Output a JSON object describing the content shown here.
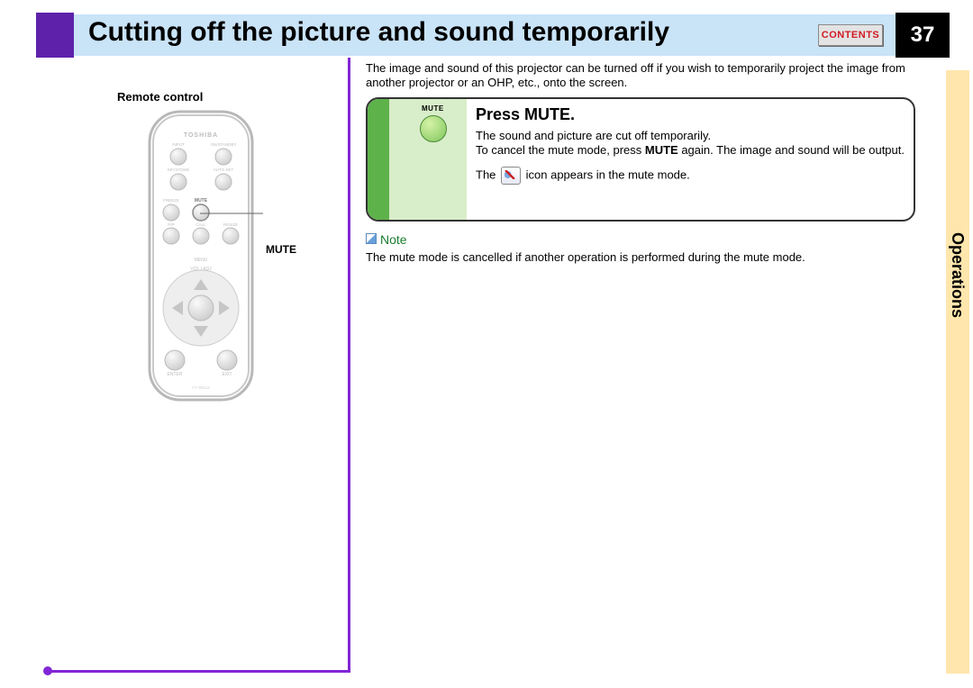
{
  "header": {
    "title": "Cutting off the picture and sound temporarily",
    "contents_label": "CONTENTS",
    "page_number": "37"
  },
  "sidetab": {
    "label": "Operations"
  },
  "left": {
    "caption": "Remote control",
    "callout": "MUTE",
    "brand": "TOSHIBA"
  },
  "intro": "The image and sound of this projector can be turned off if you wish to temporarily project the image from another projector or an OHP, etc., onto the screen.",
  "step": {
    "mute_tiny": "MUTE",
    "heading": "Press MUTE.",
    "line1": "The sound and picture are cut off temporarily.",
    "line2a": "To cancel the mute mode, press ",
    "line2b": "MUTE",
    "line2c": " again. The image and sound will be output.",
    "line3a": "The ",
    "line3b": " icon appears in the mute mode."
  },
  "note": {
    "label": "Note",
    "body": "The mute mode is cancelled if another operation is performed during the mute mode."
  }
}
